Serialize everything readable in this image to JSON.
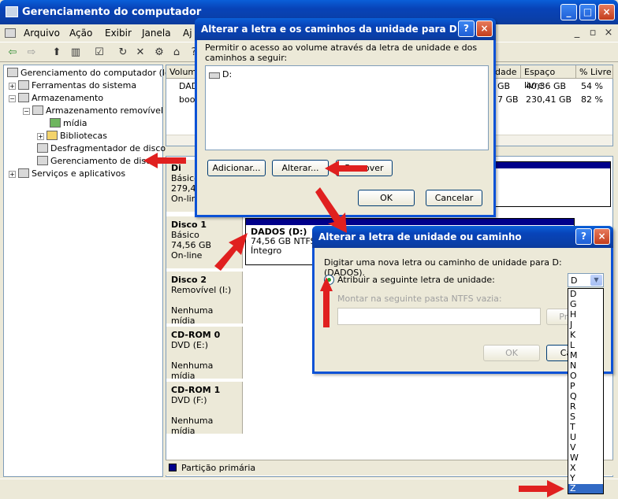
{
  "main": {
    "title": "Gerenciamento do computador",
    "menu": [
      "Arquivo",
      "Ação",
      "Exibir",
      "Janela",
      "Aj"
    ]
  },
  "tree": {
    "root": "Gerenciamento do computador (local",
    "items": [
      "Ferramentas do sistema",
      "Armazenamento",
      "Armazenamento removível",
      "mídia",
      "Bibliotecas",
      "Desfragmentador de disco",
      "Gerenciamento de disco",
      "Serviços e aplicativos"
    ]
  },
  "volume_table": {
    "headers": [
      "Volume",
      "idade",
      "Espaço livre",
      "% Livre"
    ],
    "rows": [
      {
        "name": "DAD",
        "cap": "GB",
        "free": "40,36 GB",
        "pct": "54 %"
      },
      {
        "name": "boo",
        "cap": "7 GB",
        "free": "230,41 GB",
        "pct": "82 %"
      }
    ]
  },
  "disks": [
    {
      "name": "Di",
      "type": "Básico",
      "size": "279,4",
      "status": "On-line"
    },
    {
      "name": "Disco 1",
      "type": "Básico",
      "size": "74,56 GB",
      "status": "On-line",
      "partition": {
        "label": "DADOS  (D:)",
        "size": "74,56 GB NTFS",
        "status": "Íntegro"
      }
    },
    {
      "name": "Disco 2",
      "type": "Removível (I:)",
      "media": "Nenhuma mídia"
    },
    {
      "name": "CD-ROM 0",
      "type": "DVD (E:)",
      "media": "Nenhuma mídia"
    },
    {
      "name": "CD-ROM 1",
      "type": "DVD (F:)",
      "media": "Nenhuma mídia"
    }
  ],
  "legend": "Partição primária",
  "dialog1": {
    "title": "Alterar a letra e os caminhos da unidade para D: (...",
    "help": "?",
    "close": "×",
    "prompt": "Permitir o acesso ao volume através da letra de unidade e dos caminhos a seguir:",
    "list_item": "D:",
    "add_label": "Adicionar...",
    "change_label": "Alterar...",
    "remove_label": "Remover",
    "ok_label": "OK",
    "cancel_label": "Cancelar"
  },
  "dialog2": {
    "title": "Alterar a letra de unidade ou caminho",
    "help": "?",
    "close": "×",
    "prompt": "Digitar uma nova letra ou caminho de unidade para D: (DADOS).",
    "radio1_label": "Atribuir a seguinte letra de unidade:",
    "radio2_label": "Montar na seguinte pasta NTFS vazia:",
    "browse_label": "Pro",
    "ok_label": "OK",
    "cancel_label": "Ca",
    "selected_letter": "D",
    "letters": [
      "D",
      "G",
      "H",
      "J",
      "K",
      "L",
      "M",
      "N",
      "O",
      "P",
      "Q",
      "R",
      "S",
      "T",
      "U",
      "V",
      "W",
      "X",
      "Y",
      "Z"
    ],
    "highlighted_letter": "Z"
  },
  "colors": {
    "xp_title_blue": "#0a3fa8",
    "primary_partition": "#00008b",
    "highlight_red": "#e0201f",
    "selection_blue": "#316ac5"
  }
}
